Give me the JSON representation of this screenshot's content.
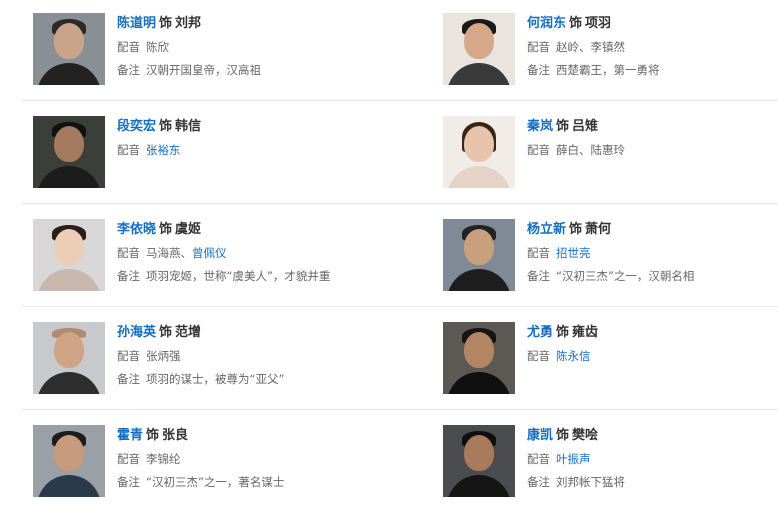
{
  "labels": {
    "as": "饰",
    "dub": "配音",
    "note": "备注"
  },
  "colors": {
    "link": "#136ec2",
    "text": "#333333",
    "muted": "#666666",
    "divider": "#e8e8e8"
  },
  "cast": [
    {
      "actor": "陈道明",
      "role": "刘邦",
      "dub": "陈欣",
      "dub_link": false,
      "note": "汉朝开国皇帝，汉高祖",
      "portrait": "portrait-man-glasses"
    },
    {
      "actor": "何润东",
      "role": "项羽",
      "dub": "赵岭、李镇然",
      "dub_link": false,
      "note": "西楚霸王，第一勇将",
      "portrait": "portrait-man-smiling"
    },
    {
      "actor": "段奕宏",
      "role": "韩信",
      "dub": "张裕东",
      "dub_link": true,
      "note": "",
      "portrait": "portrait-man-dark"
    },
    {
      "actor": "秦岚",
      "role": "吕雉",
      "dub": "薛白、陆惠玲",
      "dub_link": false,
      "note": "",
      "portrait": "portrait-woman-long-hair"
    },
    {
      "actor": "李依晓",
      "role": "虞姬",
      "dub": "马海燕、曾佩仪",
      "dub_link_part": "曾佩仪",
      "dub_plain_part": "马海燕、",
      "note": "项羽宠姬，世称“虞美人”，才貌并重",
      "portrait": "portrait-woman-updo"
    },
    {
      "actor": "杨立新",
      "role": "萧何",
      "dub": "招世亮",
      "dub_link": true,
      "note": "“汉初三杰”之一，汉朝名相",
      "portrait": "portrait-older-man"
    },
    {
      "actor": "孙海英",
      "role": "范增",
      "dub": "张炳强",
      "dub_link": false,
      "note": "项羽的谋士，被尊为“亚父”",
      "portrait": "portrait-man-bald"
    },
    {
      "actor": "尤勇",
      "role": "雍齿",
      "dub": "陈永信",
      "dub_link": true,
      "note": "",
      "portrait": "portrait-man-suit"
    },
    {
      "actor": "霍青",
      "role": "张良",
      "dub": "李锦纶",
      "dub_link": false,
      "note": "“汉初三杰”之一，著名谋士",
      "portrait": "portrait-man-short-hair"
    },
    {
      "actor": "康凯",
      "role": "樊哙",
      "dub": "叶振声",
      "dub_link": true,
      "note": "刘邦帐下猛将",
      "portrait": "portrait-man-beard"
    }
  ]
}
